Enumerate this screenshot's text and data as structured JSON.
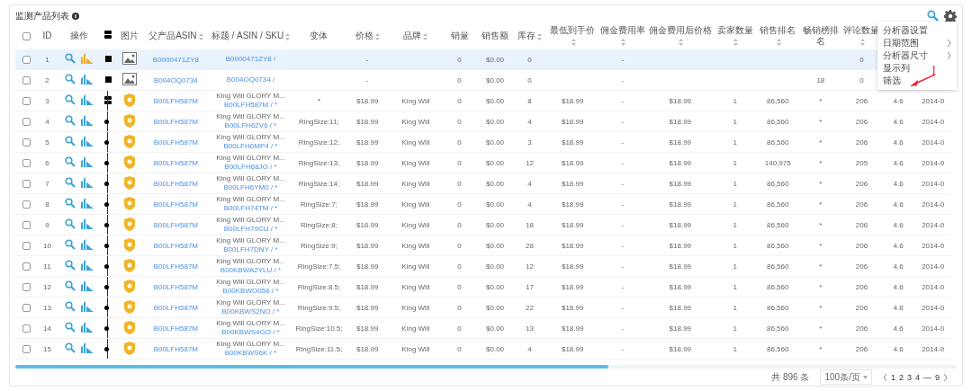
{
  "title": "监测产品列表",
  "header": {
    "checked": false,
    "columns": [
      {
        "kind": "text",
        "label": "ID",
        "sortable": false
      },
      {
        "kind": "text",
        "label": "操作",
        "sortable": false
      },
      {
        "kind": "tree-toggle"
      },
      {
        "kind": "text",
        "label": "图片",
        "sortable": false
      },
      {
        "kind": "text",
        "label": "父产品ASIN",
        "sortable": true
      },
      {
        "kind": "text",
        "label": "标题 / ASIN / SKU",
        "sortable": true
      },
      {
        "kind": "text",
        "label": "变体",
        "sortable": false
      },
      {
        "kind": "text",
        "label": "价格",
        "sortable": true
      },
      {
        "kind": "text",
        "label": "品牌",
        "sortable": true
      },
      {
        "kind": "text",
        "label": "销量",
        "sortable": false
      },
      {
        "kind": "text",
        "label": "销售额",
        "sortable": false
      },
      {
        "kind": "text",
        "label": "库存",
        "sortable": true
      },
      {
        "kind": "text",
        "label": "最低到手价",
        "sortable": true
      },
      {
        "kind": "text",
        "label": "佣金费用率",
        "sortable": true
      },
      {
        "kind": "text",
        "label": "佣金费用后价格",
        "sortable": true
      },
      {
        "kind": "text",
        "label": "卖家数量",
        "sortable": true
      },
      {
        "kind": "text",
        "label": "销售排名",
        "sortable": true
      },
      {
        "kind": "text",
        "label": "畅销榜排名",
        "sortable": false
      },
      {
        "kind": "text",
        "label": "评论数量",
        "sortable": true
      }
    ]
  },
  "rows": [
    {
      "checked": false,
      "highlighted": true,
      "id": "1",
      "color": "#f5a623",
      "kind": "single",
      "parent_asin": "B0000471ZY8",
      "title_asin": "B0000471ZY8 /",
      "cells": [
        null,
        "-",
        null,
        "0",
        "$0.00",
        "0",
        null,
        "-",
        null,
        null,
        null,
        null,
        "0"
      ]
    },
    {
      "checked": false,
      "highlighted": false,
      "id": "2",
      "color": "#3aa3d8",
      "kind": "single",
      "parent_asin": "B004OQ0734",
      "title_asin": "B004OQ0734 /",
      "cells": [
        null,
        "-",
        null,
        "0",
        "$0.00",
        "0",
        null,
        "-",
        null,
        null,
        null,
        "18",
        "0"
      ]
    },
    {
      "checked": false,
      "highlighted": false,
      "id": "3",
      "color": "#3aa3d8",
      "kind": "parent",
      "parent_asin": "B00LFH587M",
      "title": "King Will GLORY M...",
      "title_asin": "B00LFH587M / *",
      "cells": [
        "*",
        "$18.99",
        "King Will",
        "0",
        "$0.00",
        "8",
        "$18.99",
        "-",
        "$18.99",
        "1",
        "86,560",
        "*",
        "206",
        "4.6",
        "2014-0"
      ]
    },
    {
      "checked": false,
      "highlighted": false,
      "id": "4",
      "color": "#3aa3d8",
      "kind": "child",
      "parent_asin": "B00LFH587M",
      "title": "King Will GLORY M...",
      "title_asin": "B00LFH62V6 / *",
      "cells": [
        "RingSize:11;",
        "$18.99",
        "King Will",
        "0",
        "$0.00",
        "4",
        "$18.99",
        "-",
        "$18.99",
        "1",
        "86,560",
        "*",
        "206",
        "4.6",
        "2014-0"
      ]
    },
    {
      "checked": false,
      "highlighted": false,
      "id": "5",
      "color": "#3aa3d8",
      "kind": "child",
      "parent_asin": "B00LFH587M",
      "title": "King Will GLORY M...",
      "title_asin": "B00LFH6MP4 / *",
      "cells": [
        "RingSize:12;",
        "$18.99",
        "King Will",
        "0",
        "$0.00",
        "3",
        "$18.99",
        "-",
        "$18.99",
        "1",
        "86,560",
        "*",
        "206",
        "4.6",
        "2014-0"
      ]
    },
    {
      "checked": false,
      "highlighted": false,
      "id": "6",
      "color": "#3aa3d8",
      "kind": "child",
      "parent_asin": "B00LFH587M",
      "title": "King Will GLORY M...",
      "title_asin": "B00LFH68JO / *",
      "cells": [
        "RingSize:13;",
        "$18.99",
        "King Will",
        "0",
        "$0.00",
        "12",
        "$18.99",
        "-",
        "$18.99",
        "1",
        "140,975",
        "*",
        "205",
        "4.6",
        "2014-0"
      ]
    },
    {
      "checked": false,
      "highlighted": false,
      "id": "7",
      "color": "#3aa3d8",
      "kind": "child",
      "parent_asin": "B00LFH587M",
      "title": "King Will GLORY M...",
      "title_asin": "B00LFH6YM0 / *",
      "cells": [
        "RingSize:14;",
        "$18.99",
        "King Will",
        "0",
        "$0.00",
        "4",
        "$18.99",
        "-",
        "$18.99",
        "1",
        "86,560",
        "*",
        "206",
        "4.6",
        "2014-0"
      ]
    },
    {
      "checked": false,
      "highlighted": false,
      "id": "8",
      "color": "#3aa3d8",
      "kind": "child",
      "parent_asin": "B00LFH587M",
      "title": "King Will GLORY M...",
      "title_asin": "B00LFH74TM / *",
      "cells": [
        "RingSize:7;",
        "$18.99",
        "King Will",
        "0",
        "$0.00",
        "4",
        "$18.99",
        "-",
        "$18.99",
        "1",
        "86,560",
        "*",
        "206",
        "4.6",
        "2014-0"
      ]
    },
    {
      "checked": false,
      "highlighted": false,
      "id": "9",
      "color": "#3aa3d8",
      "kind": "child",
      "parent_asin": "B00LFH587M",
      "title": "King Will GLORY M...",
      "title_asin": "B00LFH79CU / *",
      "cells": [
        "RingSize:8;",
        "$18.99",
        "King Will",
        "0",
        "$0.00",
        "18",
        "$18.99",
        "-",
        "$18.99",
        "1",
        "86,560",
        "*",
        "206",
        "4.6",
        "2014-0"
      ]
    },
    {
      "checked": false,
      "highlighted": false,
      "id": "10",
      "color": "#3aa3d8",
      "kind": "child",
      "parent_asin": "B00LFH587M",
      "title": "King Will GLORY M...",
      "title_asin": "B00LFH7DNY / *",
      "cells": [
        "RingSize:9;",
        "$18.99",
        "King Will",
        "0",
        "$0.00",
        "28",
        "$18.99",
        "-",
        "$18.99",
        "1",
        "86,560",
        "*",
        "206",
        "4.6",
        "2014-0"
      ]
    },
    {
      "checked": false,
      "highlighted": false,
      "id": "11",
      "color": "#3aa3d8",
      "kind": "child",
      "parent_asin": "B00LFH587M",
      "title": "King Will GLORY M...",
      "title_asin": "B00KBWA2YLU / *",
      "cells": [
        "RingSize:7.5;",
        "$18.99",
        "King Will",
        "0",
        "$0.00",
        "12",
        "$18.99",
        "-",
        "$18.99",
        "1",
        "86,560",
        "*",
        "206",
        "4.6",
        "2014-0"
      ]
    },
    {
      "checked": false,
      "highlighted": false,
      "id": "12",
      "color": "#3aa3d8",
      "kind": "child",
      "parent_asin": "B00LFH587M",
      "title": "King Will GLORY M...",
      "title_asin": "B00KBWO056 / *",
      "cells": [
        "RingSize:8.5;",
        "$18.99",
        "King Will",
        "0",
        "$0.00",
        "17",
        "$18.99",
        "-",
        "$18.99",
        "1",
        "86,560",
        "*",
        "206",
        "4.6",
        "2014-0"
      ]
    },
    {
      "checked": false,
      "highlighted": false,
      "id": "13",
      "color": "#3aa3d8",
      "kind": "child",
      "parent_asin": "B00LFH587M",
      "title": "King Will GLORY M...",
      "title_asin": "B00KBWS2NO / *",
      "cells": [
        "RingSize:9.5;",
        "$18.99",
        "King Will",
        "0",
        "$0.00",
        "22",
        "$18.99",
        "-",
        "$18.99",
        "1",
        "86,560",
        "*",
        "206",
        "4.6",
        "2014-0"
      ]
    },
    {
      "checked": false,
      "highlighted": false,
      "id": "14",
      "color": "#3aa3d8",
      "kind": "child",
      "parent_asin": "B00LFH587M",
      "title": "King Will GLORY M...",
      "title_asin": "B00KBWS4GO / *",
      "cells": [
        "RingSize:10.5;",
        "$18.99",
        "King Will",
        "0",
        "$0.00",
        "13",
        "$18.99",
        "-",
        "$18.99",
        "1",
        "86,560",
        "*",
        "206",
        "4.6",
        "2014-0"
      ]
    },
    {
      "checked": false,
      "highlighted": false,
      "id": "15",
      "color": "#3aa3d8",
      "kind": "child",
      "parent_asin": "B00LFH587M",
      "title": "King Will GLORY M...",
      "title_asin": "B00KBWS6K / *",
      "cells": [
        "RingSize:11.5;",
        "$18.99",
        "King Will",
        "0",
        "$0.00",
        "4",
        "$18.99",
        "-",
        "$18.99",
        "1",
        "86,560",
        "*",
        "206",
        "4.6",
        "2014-0"
      ]
    }
  ],
  "menu": {
    "items": [
      {
        "label": "分析器设置",
        "has_submenu": false
      },
      {
        "label": "日期范围",
        "has_submenu": true
      },
      {
        "label": "分析器尺寸",
        "has_submenu": true
      },
      {
        "label": "显示列",
        "has_submenu": false
      },
      {
        "label": "筛选",
        "has_submenu": false
      }
    ],
    "annotation": "1"
  },
  "footer": {
    "total": "共 896 条",
    "page_size": "100条/页",
    "pages": [
      "1",
      "2",
      "3",
      "4",
      "—",
      "9"
    ]
  }
}
